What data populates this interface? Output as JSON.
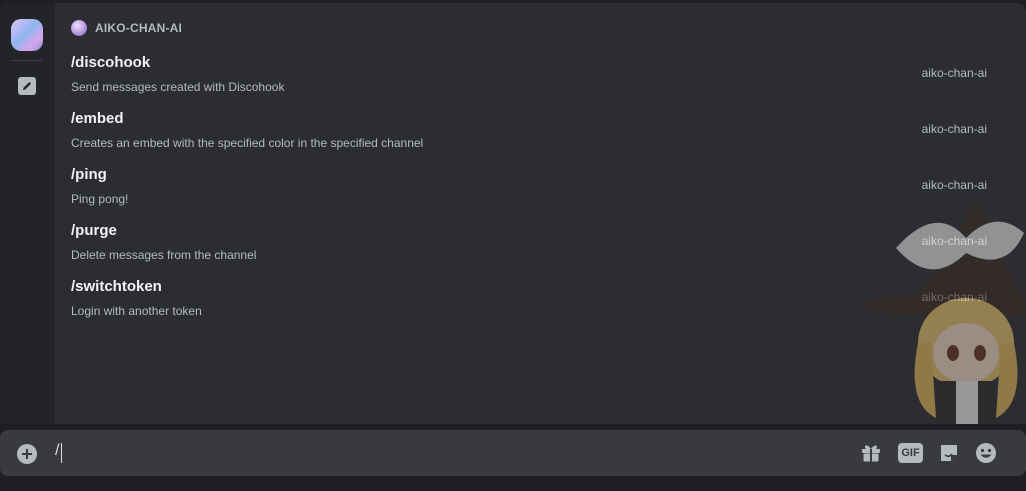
{
  "header": {
    "title": "AIKO-CHAN-AI"
  },
  "commands": [
    {
      "name": "/discohook",
      "description": "Send messages created with Discohook",
      "source": "aiko-chan-ai"
    },
    {
      "name": "/embed",
      "description": "Creates an embed with the specified color in the specified channel",
      "source": "aiko-chan-ai"
    },
    {
      "name": "/ping",
      "description": "Ping pong!",
      "source": "aiko-chan-ai"
    },
    {
      "name": "/purge",
      "description": "Delete messages from the channel",
      "source": "aiko-chan-ai"
    },
    {
      "name": "/switchtoken",
      "description": "Login with another token",
      "source": "aiko-chan-ai"
    }
  ],
  "input": {
    "value": "/"
  },
  "toolbar": {
    "gif_label": "GIF"
  },
  "icons": {
    "rail_edit": "pencil-icon",
    "plus": "plus-circle-icon",
    "gift": "gift-icon",
    "gif": "gif-icon",
    "sticker": "sticker-icon",
    "emoji": "emoji-icon"
  },
  "colors": {
    "background": "#1e1f22",
    "popup": "#2b2d31",
    "input": "#383a40",
    "text": "#f2f3f5",
    "muted": "#b5bac1"
  }
}
